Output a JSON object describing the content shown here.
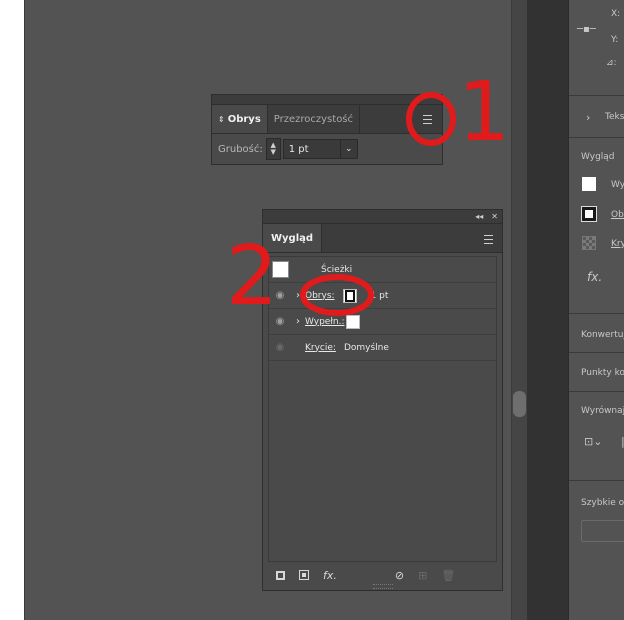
{
  "stroke_panel": {
    "tabs": [
      {
        "label": "Obrys",
        "arrow": "⇕",
        "active": true
      },
      {
        "label": "Przezroczystość",
        "active": false
      }
    ],
    "weight_label": "Grubość:",
    "weight_value": "1 pt"
  },
  "appearance_panel": {
    "title": "Wygląd",
    "topbar": {
      "collapse": "◂◂",
      "close": "✕"
    },
    "rows": [
      {
        "label": "Ścieżki"
      },
      {
        "label": "Obrys:",
        "value": "1 pt"
      },
      {
        "label": "Wypełn.:"
      },
      {
        "label": "Krycie:",
        "value": "Domyślne"
      }
    ],
    "footer_fx": "fx."
  },
  "annotations": {
    "one": "1",
    "two": "2"
  },
  "right_panel": {
    "x_label": "X:",
    "y_label": "Y:",
    "angle_label": "⊿:",
    "text_section": "Teks",
    "appearance_title": "Wygląd",
    "item_fill": "Wy",
    "item_stroke": "Obr",
    "item_opacity": "Kry",
    "fx": "fx.",
    "convert": "Konwertuj",
    "anchor_points": "Punkty ko",
    "align": "Wyrównaj",
    "quick_actions": "Szybkie op"
  },
  "colors": {
    "annotation": "#e11b1b",
    "panel": "#4a4a4a",
    "tabbar": "#3c3c3c"
  }
}
